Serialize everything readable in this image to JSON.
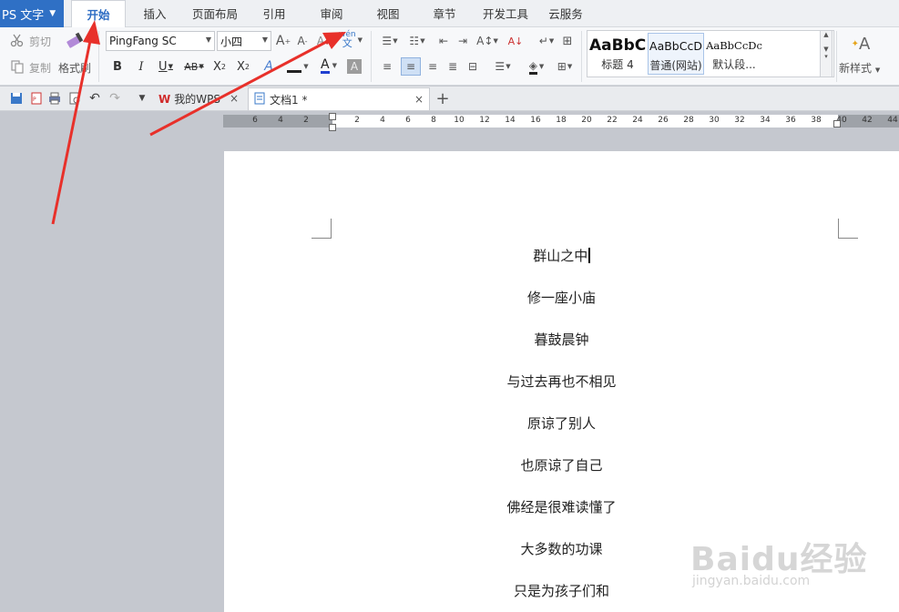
{
  "app": {
    "title": "PS 文字"
  },
  "menu": {
    "tabs": [
      "开始",
      "插入",
      "页面布局",
      "引用",
      "审阅",
      "视图",
      "章节",
      "开发工具",
      "云服务"
    ],
    "active_index": 0
  },
  "ribbon": {
    "cut_label": "剪切",
    "copy_label": "复制",
    "format_painter_label": "格式刷",
    "font_name": "PingFang SC",
    "font_size": "小四",
    "styles": [
      {
        "sample": "AaBbC",
        "name": "标题 4"
      },
      {
        "sample": "AaBbCcD",
        "name": "普通(网站)"
      },
      {
        "sample": "AaBbCcDc",
        "name": "默认段..."
      }
    ],
    "new_style_label": "新样式"
  },
  "doc_tabs": [
    {
      "label": "我的WPS"
    },
    {
      "label": "文档1 *"
    }
  ],
  "ruler": {
    "ticks": [
      "6",
      "4",
      "2",
      "",
      "2",
      "4",
      "6",
      "8",
      "10",
      "12",
      "14",
      "16",
      "18",
      "20",
      "22",
      "24",
      "26",
      "28",
      "30",
      "32",
      "34",
      "36",
      "38",
      "40",
      "42",
      "44"
    ]
  },
  "document": {
    "lines": [
      "群山之中",
      "修一座小庙",
      "暮鼓晨钟",
      "与过去再也不相见",
      "原谅了别人",
      "也原谅了自己",
      "佛经是很难读懂了",
      "大多数的功课",
      "只是为孩子们和"
    ]
  },
  "watermark": {
    "brand": "Baidu经验",
    "url": "jingyan.baidu.com"
  },
  "colors": {
    "accent": "#2f70c5",
    "arrow": "#e8302a"
  }
}
